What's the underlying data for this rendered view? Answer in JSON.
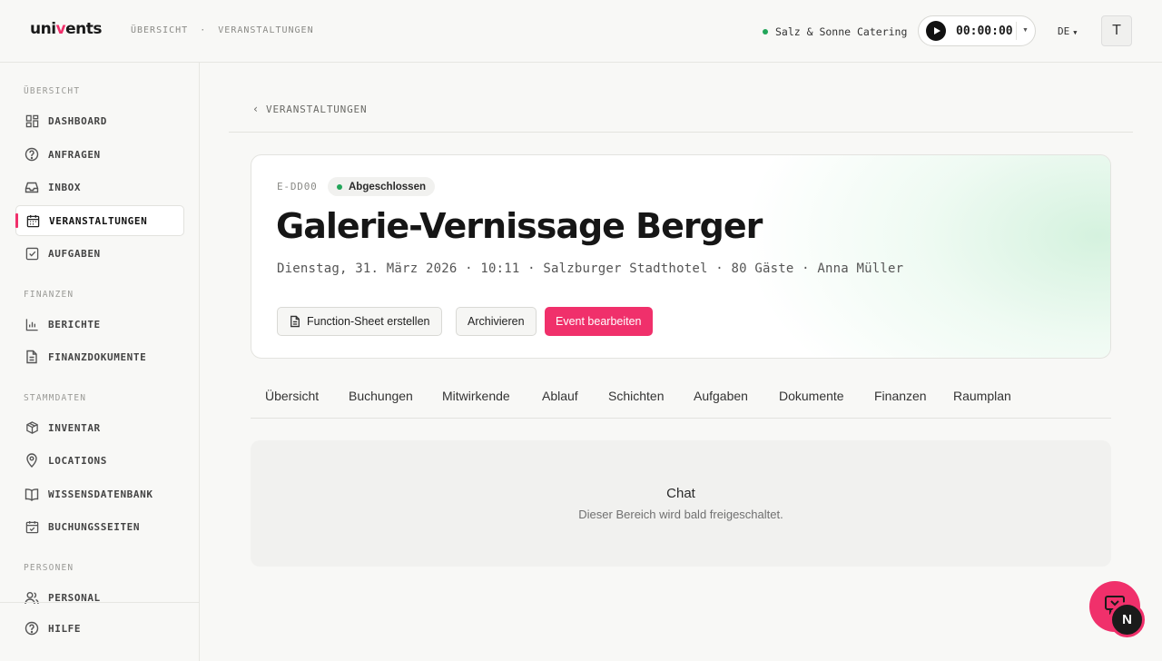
{
  "header": {
    "logo_left": "uni",
    "logo_accent": "v",
    "logo_right": "ents",
    "breadcrumb": [
      "ÜBERSICHT",
      "·",
      "VERANSTALTUNGEN"
    ],
    "company": "Salz & Sonne Catering",
    "timer": "00:00:00",
    "language": "DE",
    "avatar_initial": "T"
  },
  "sidebar": {
    "sections": [
      {
        "title": "ÜBERSICHT"
      },
      {
        "title": "FINANZEN"
      },
      {
        "title": "STAMMDATEN"
      },
      {
        "title": "PERSONEN"
      }
    ],
    "items": [
      {
        "label": "DASHBOARD",
        "icon": "dashboard-icon"
      },
      {
        "label": "ANFRAGEN",
        "icon": "question-icon"
      },
      {
        "label": "INBOX",
        "icon": "inbox-icon"
      },
      {
        "label": "VERANSTALTUNGEN",
        "icon": "calendar-icon",
        "active": true
      },
      {
        "label": "AUFGABEN",
        "icon": "checkbox-icon"
      },
      {
        "label": "BERICHTE",
        "icon": "bar-chart-icon"
      },
      {
        "label": "FINANZDOKUMENTE",
        "icon": "document-icon"
      },
      {
        "label": "INVENTAR",
        "icon": "box-icon"
      },
      {
        "label": "LOCATIONS",
        "icon": "map-pin-icon"
      },
      {
        "label": "WISSENSDATENBANK",
        "icon": "book-icon"
      },
      {
        "label": "BUCHUNGSSEITEN",
        "icon": "calendar-check-icon"
      },
      {
        "label": "PERSONAL",
        "icon": "users-icon"
      }
    ],
    "footer": {
      "label": "HILFE",
      "icon": "help-icon"
    }
  },
  "main": {
    "back_label": "VERANSTALTUNGEN",
    "event": {
      "code": "E-DD00",
      "status": "Abgeschlossen",
      "title": "Galerie-Vernissage Berger",
      "subtitle": "Dienstag, 31. März 2026 · 10:11 · Salzburger Stadthotel · 80 Gäste · Anna Müller"
    },
    "actions": {
      "function_sheet": "Function-Sheet erstellen",
      "archive": "Archivieren",
      "edit": "Event bearbeiten"
    },
    "tabs": [
      "Übersicht",
      "Buchungen",
      "Mitwirkende",
      "Ablauf",
      "Schichten",
      "Aufgaben",
      "Dokumente",
      "Finanzen",
      "Raumplan"
    ],
    "panel": {
      "title": "Chat",
      "text": "Dieser Bereich wird bald freigeschaltet."
    }
  },
  "floating": {
    "badge_letter": "N"
  },
  "colors": {
    "accent": "#f0306b",
    "status_green": "#22a559"
  }
}
